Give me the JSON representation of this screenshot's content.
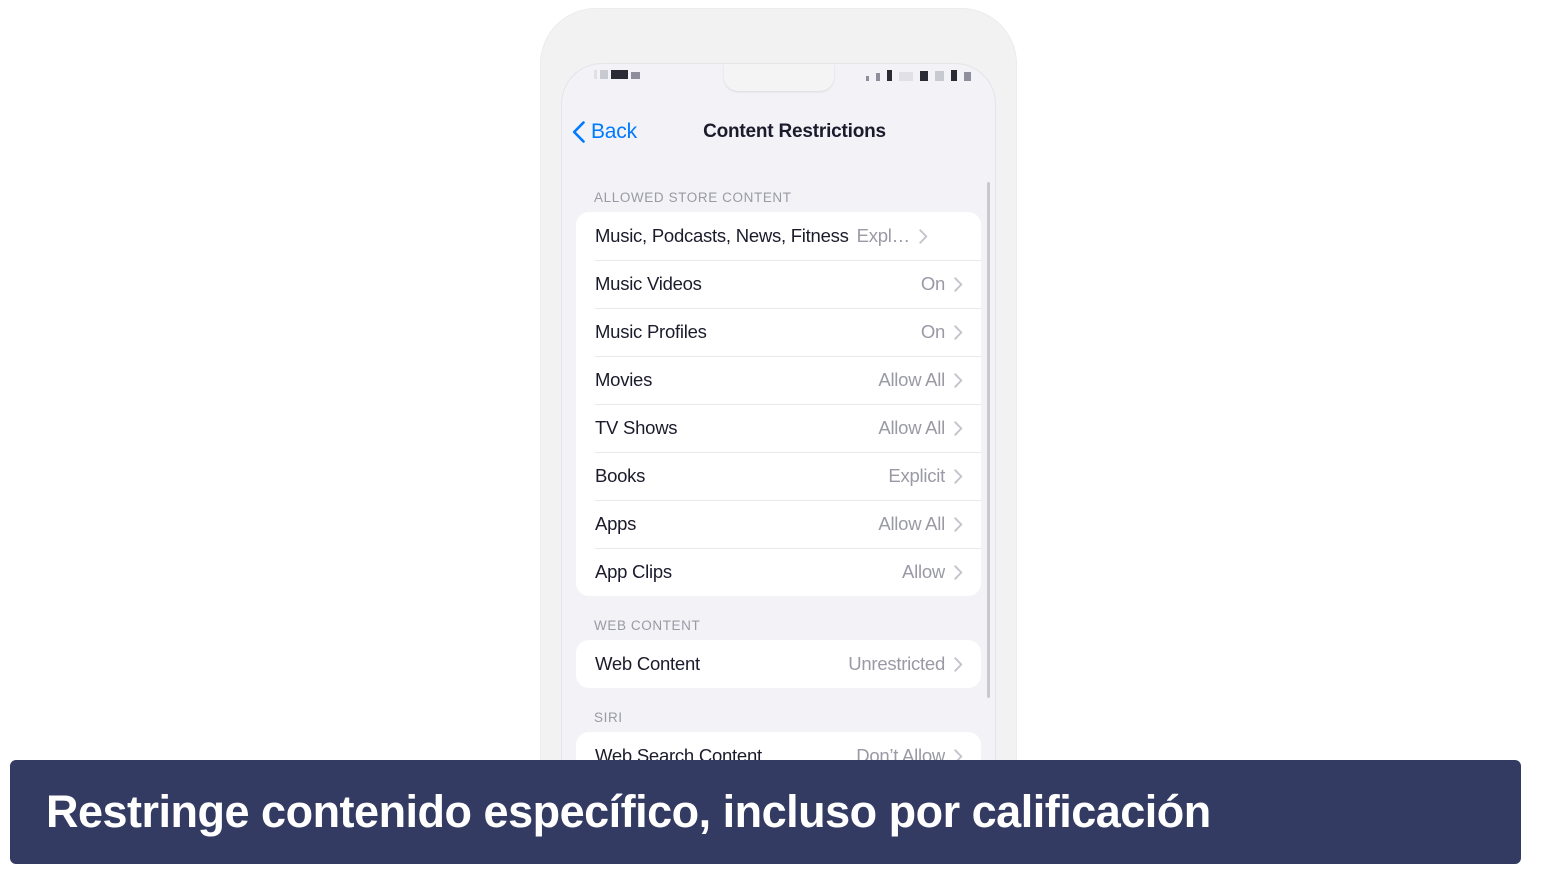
{
  "device": {
    "status_bar": {
      "note": "pixelated-censored",
      "left_blocks": [
        {
          "w": 3,
          "h": 9,
          "tone": "faint"
        },
        {
          "w": 8,
          "h": 9,
          "tone": "dim"
        },
        {
          "w": 17,
          "h": 9,
          "tone": "dark"
        },
        {
          "w": 9,
          "h": 7,
          "tone": "mid"
        }
      ],
      "right_blocks": [
        {
          "w": 3,
          "h": 5,
          "tone": "mid"
        },
        {
          "w": 4,
          "h": 8,
          "tone": "mid"
        },
        {
          "w": 5,
          "h": 11,
          "tone": "dark"
        },
        {
          "w": 14,
          "h": 9,
          "tone": "faint"
        },
        {
          "w": 8,
          "h": 10,
          "tone": "dark"
        },
        {
          "w": 9,
          "h": 10,
          "tone": "dim"
        },
        {
          "w": 6,
          "h": 11,
          "tone": "dark"
        },
        {
          "w": 7,
          "h": 9,
          "tone": "mid"
        }
      ]
    },
    "navbar": {
      "back_label": "Back",
      "title": "Content Restrictions",
      "back_icon": "chevron-left-icon",
      "accent_color": "#007aff",
      "title_color": "#1b1b2c"
    },
    "sections": [
      {
        "header": "ALLOWED STORE CONTENT",
        "rows": [
          {
            "label": "Music, Podcasts, News, Fitness",
            "value": "Expl…",
            "truncated": true
          },
          {
            "label": "Music Videos",
            "value": "On"
          },
          {
            "label": "Music Profiles",
            "value": "On"
          },
          {
            "label": "Movies",
            "value": "Allow All"
          },
          {
            "label": "TV Shows",
            "value": "Allow All"
          },
          {
            "label": "Books",
            "value": "Explicit"
          },
          {
            "label": "Apps",
            "value": "Allow All"
          },
          {
            "label": "App Clips",
            "value": "Allow"
          }
        ]
      },
      {
        "header": "WEB CONTENT",
        "rows": [
          {
            "label": "Web Content",
            "value": "Unrestricted"
          }
        ]
      },
      {
        "header": "SIRI",
        "rows": [
          {
            "label": "Web Search Content",
            "value": "Don’t Allow",
            "clipped": true
          }
        ]
      }
    ],
    "scrollbar": {
      "visible": true
    }
  },
  "caption": {
    "text": "Restringe contenido específico, incluso por calificación",
    "background_color": "#343b63",
    "text_color": "#ffffff"
  }
}
